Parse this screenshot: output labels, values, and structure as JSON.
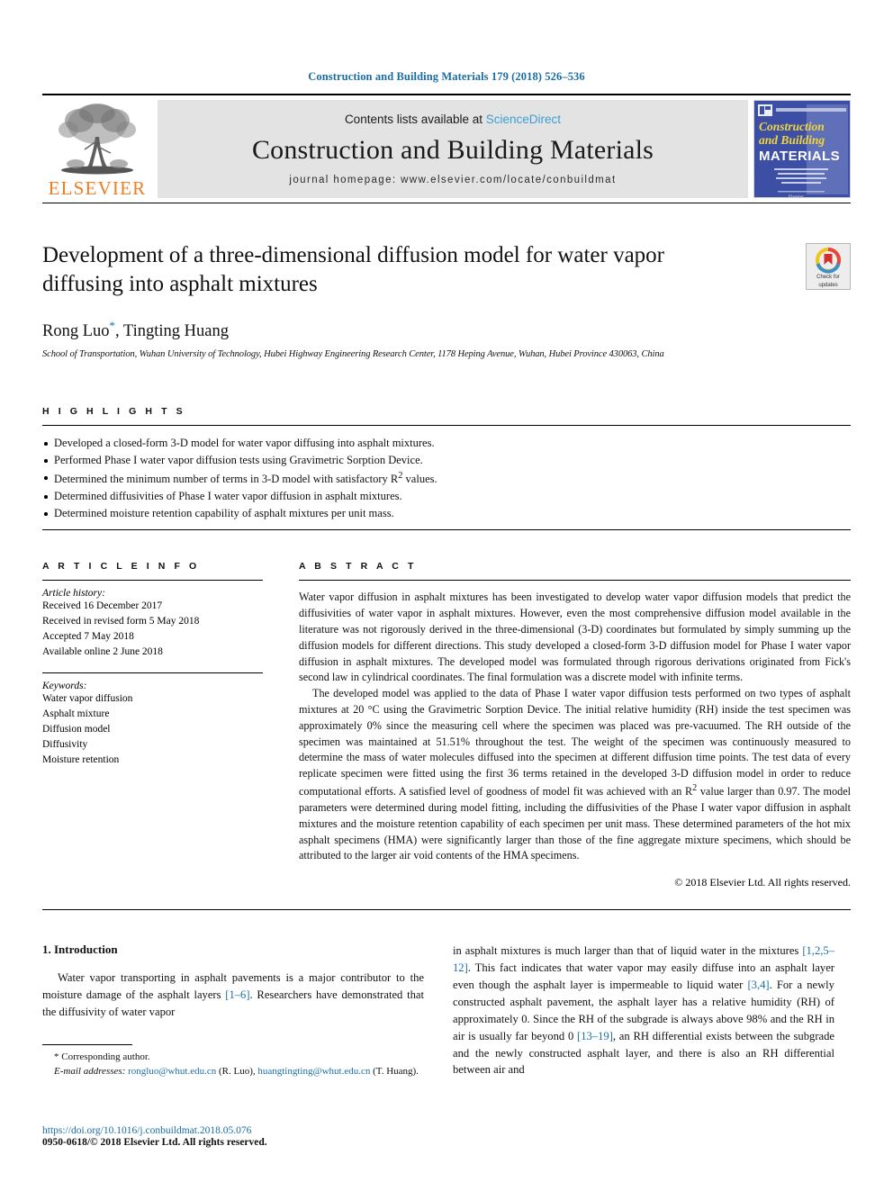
{
  "running_head": "Construction and Building Materials 179 (2018) 526–536",
  "masthead": {
    "publisher_name": "ELSEVIER",
    "contents_prefix": "Contents lists available at ",
    "contents_link": "ScienceDirect",
    "journal_title": "Construction and Building Materials",
    "homepage": "journal homepage: www.elsevier.com/locate/conbuildmat",
    "cover": {
      "line1": "Construction",
      "line2": "and Building",
      "line3": "MATERIALS",
      "blurb": "An International Journal Dedicated to the Investigation and Innovative Use of Materials in Construction and Repair",
      "footer": "Elsevier",
      "bg_color": "#3c4fa5",
      "accent_color": "#f2d53c"
    }
  },
  "article": {
    "title": "Development of a three-dimensional diffusion model for water vapor diffusing into asphalt mixtures",
    "authors_pre": "Rong Luo",
    "author_star": "*",
    "authors_post": ", Tingting Huang",
    "affiliation": "School of Transportation, Wuhan University of Technology, Hubei Highway Engineering Research Center, 1178 Heping Avenue, Wuhan, Hubei Province 430063, China",
    "crossmark_line1": "Check for",
    "crossmark_line2": "updates"
  },
  "highlights": {
    "label": "H I G H L I G H T S",
    "items": [
      "Developed a closed-form 3-D model for water vapor diffusing into asphalt mixtures.",
      "Performed Phase I water vapor diffusion tests using Gravimetric Sorption Device.",
      "Determined the minimum number of terms in 3-D model with satisfactory R2 values.",
      "Determined diffusivities of Phase I water vapor diffusion in asphalt mixtures.",
      "Determined moisture retention capability of asphalt mixtures per unit mass."
    ]
  },
  "article_info": {
    "label": "A R T I C L E  I N F O",
    "history_head": "Article history:",
    "history": [
      "Received 16 December 2017",
      "Received in revised form 5 May 2018",
      "Accepted 7 May 2018",
      "Available online 2 June 2018"
    ],
    "keywords_head": "Keywords:",
    "keywords": [
      "Water vapor diffusion",
      "Asphalt mixture",
      "Diffusion model",
      "Diffusivity",
      "Moisture retention"
    ]
  },
  "abstract": {
    "label": "A B S T R A C T",
    "paragraph1": "Water vapor diffusion in asphalt mixtures has been investigated to develop water vapor diffusion models that predict the diffusivities of water vapor in asphalt mixtures. However, even the most comprehensive diffusion model available in the literature was not rigorously derived in the three-dimensional (3-D) coordinates but formulated by simply summing up the diffusion models for different directions. This study developed a closed-form 3-D diffusion model for Phase I water vapor diffusion in asphalt mixtures. The developed model was formulated through rigorous derivations originated from Fick's second law in cylindrical coordinates. The final formulation was a discrete model with infinite terms.",
    "paragraph2": "The developed model was applied to the data of Phase I water vapor diffusion tests performed on two types of asphalt mixtures at 20 °C using the Gravimetric Sorption Device. The initial relative humidity (RH) inside the test specimen was approximately 0% since the measuring cell where the specimen was placed was pre-vacuumed. The RH outside of the specimen was maintained at 51.51% throughout the test. The weight of the specimen was continuously measured to determine the mass of water molecules diffused into the specimen at different diffusion time points. The test data of every replicate specimen were fitted using the first 36 terms retained in the developed 3-D diffusion model in order to reduce computational efforts. A satisfied level of goodness of model fit was achieved with an R2 value larger than 0.97. The model parameters were determined during model fitting, including the diffusivities of the Phase I water vapor diffusion in asphalt mixtures and the moisture retention capability of each specimen per unit mass. These determined parameters of the hot mix asphalt specimens (HMA) were significantly larger than those of the fine aggregate mixture specimens, which should be attributed to the larger air void contents of the HMA specimens.",
    "copyright": "© 2018 Elsevier Ltd. All rights reserved."
  },
  "introduction": {
    "section_title": "1. Introduction",
    "left_paragraph_a": "Water vapor transporting in asphalt pavements is a major contributor to the moisture damage of the asphalt layers ",
    "left_ref_1": "[1–6]",
    "left_paragraph_b": ". Researchers have demonstrated that the diffusivity of water vapor",
    "right_paragraph_a": "in asphalt mixtures is much larger than that of liquid water in the mixtures ",
    "right_ref_1": "[1,2,5–12]",
    "right_paragraph_b": ". This fact indicates that water vapor may easily diffuse into an asphalt layer even though the asphalt layer is impermeable to liquid water ",
    "right_ref_2": "[3,4]",
    "right_paragraph_c": ". For a newly constructed asphalt pavement, the asphalt layer has a relative humidity (RH) of approximately 0. Since the RH of the subgrade is always above 98% and the RH in air is usually far beyond 0 ",
    "right_ref_3": "[13–19]",
    "right_paragraph_d": ", an RH differential exists between the subgrade and the newly constructed asphalt layer, and there is also an RH differential between air and"
  },
  "footnote": {
    "corresponding": "* Corresponding author.",
    "email_label": "E-mail addresses:",
    "email1": "rongluo@whut.edu.cn",
    "email1_name": "(R. Luo),",
    "email2": "huangtingting@whut.edu.cn",
    "email2_name": "(T. Huang)."
  },
  "footer": {
    "doi": "https://doi.org/10.1016/j.conbuildmat.2018.05.076",
    "issn": "0950-0618/© 2018 Elsevier Ltd. All rights reserved."
  },
  "colors": {
    "link_blue": "#1a6ea5",
    "sciencedirect_blue": "#3a9fd4",
    "elsevier_orange": "#ef7d22",
    "banner_gray": "#e3e3e3"
  }
}
